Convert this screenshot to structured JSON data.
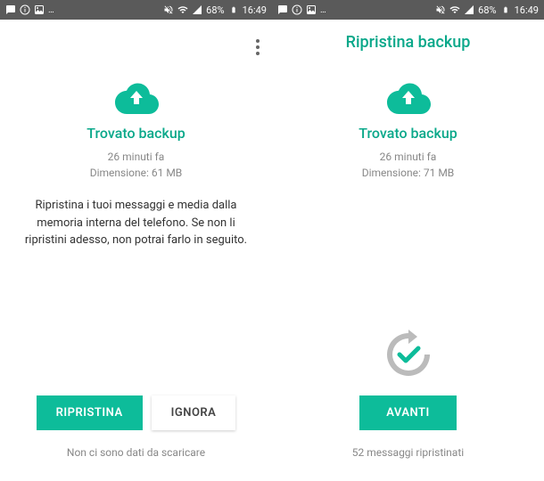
{
  "statusbar": {
    "battery": "68%",
    "time": "16:49"
  },
  "left": {
    "found_title": "Trovato backup",
    "time_ago": "26 minuti fa",
    "size_line": "Dimensione: 61 MB",
    "description": "Ripristina i tuoi messaggi e media dalla memoria interna del telefono. Se non li ripristini adesso, non potrai farlo in seguito.",
    "restore_button": "RIPRISTINA",
    "ignore_button": "IGNORA",
    "footer": "Non ci sono dati da scaricare"
  },
  "right": {
    "header_title": "Ripristina backup",
    "found_title": "Trovato backup",
    "time_ago": "26 minuti fa",
    "size_line": "Dimensione: 71 MB",
    "next_button": "AVANTI",
    "footer": "52 messaggi ripristinati"
  },
  "colors": {
    "accent": "#0aa88a",
    "button": "#0dbc9a"
  }
}
